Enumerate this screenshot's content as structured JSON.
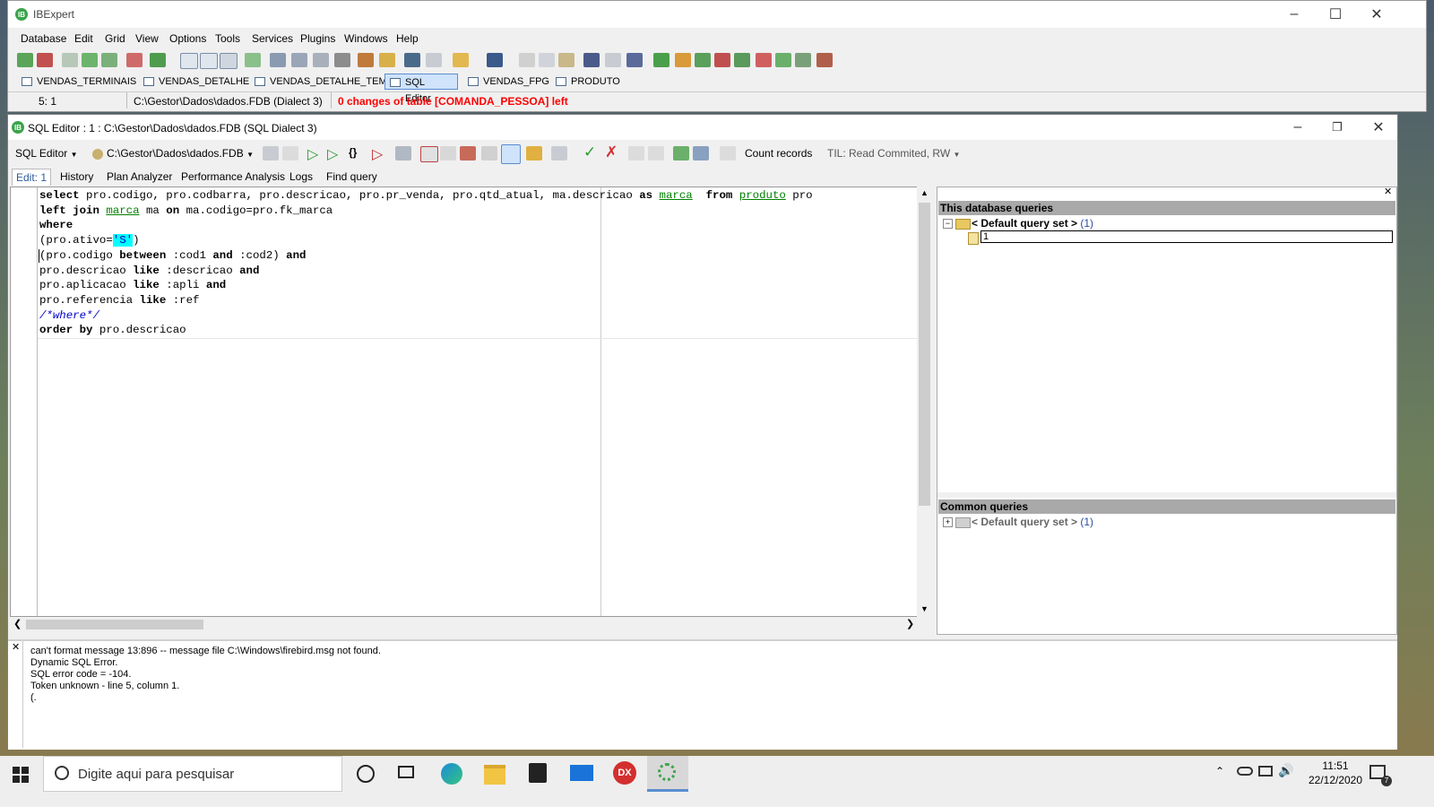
{
  "main_window": {
    "title": "IBExpert",
    "menu": [
      "Database",
      "Edit",
      "Grid",
      "View",
      "Options",
      "Tools",
      "Services",
      "Plugins",
      "Windows",
      "Help"
    ],
    "window_tabs": [
      {
        "label": "VENDAS_TERMINAIS",
        "active": false
      },
      {
        "label": "VENDAS_DETALHE",
        "active": false
      },
      {
        "label": "VENDAS_DETALHE_TEMP",
        "active": false
      },
      {
        "label": "SQL Editor",
        "active": true
      },
      {
        "label": "VENDAS_FPG",
        "active": false
      },
      {
        "label": "PRODUTO",
        "active": false
      }
    ],
    "status": {
      "position": "5:   1",
      "database": "C:\\Gestor\\Dados\\dados.FDB (Dialect 3)",
      "message": "0 changes of table [COMANDA_PESSOA] left"
    }
  },
  "sql_editor": {
    "title": "SQL Editor : 1 : C:\\Gestor\\Dados\\dados.FDB (SQL Dialect 3)",
    "toolbar": {
      "mode": "SQL Editor",
      "database": "C:\\Gestor\\Dados\\dados.FDB",
      "count_records": "Count records",
      "til": "TIL: Read Commited, RW"
    },
    "subtabs": [
      "Edit: 1",
      "History",
      "Plan Analyzer",
      "Performance Analysis",
      "Logs",
      "Find query"
    ],
    "code_lines": {
      "l1_select": "select",
      "l1_cols": " pro.codigo, pro.codbarra, pro.descricao, pro.pr_venda, pro.qtd_atual, ma.descricao ",
      "l1_as": "as",
      "l1_marca": "marca",
      "l1_from": "from",
      "l1_produto": "produto",
      "l1_pro": " pro",
      "l2_left": "left join",
      "l2_marca": "marca",
      "l2_ma": " ma ",
      "l2_on": "on",
      "l2_rest": " ma.codigo=pro.fk_marca",
      "l3": "where",
      "l4_pre": "(pro.ativo=",
      "l4_str": "'S'",
      "l4_post": ")",
      "l5_pre": "(pro.codigo ",
      "l5_between": "between",
      "l5_mid": " :cod1 ",
      "l5_and": "and",
      "l5_mid2": " :cod2) ",
      "l5_and2": "and",
      "l6_pre": "pro.descricao ",
      "l6_like": "like",
      "l6_mid": " :descricao ",
      "l6_and": "and",
      "l7_pre": "pro.aplicacao ",
      "l7_like": "like",
      "l7_mid": " :apli ",
      "l7_and": "and",
      "l8_pre": "pro.referencia ",
      "l8_like": "like",
      "l8_mid": " :ref",
      "l9": "/*where*/",
      "l10_order": "order by",
      "l10_rest": " pro.descricao"
    },
    "right_panel": {
      "db_queries_header": "This database queries",
      "db_query_set": "< Default query set >",
      "db_query_count": "(1)",
      "db_query_item": "1",
      "common_header": "Common queries",
      "common_query_set": "< Default query set >",
      "common_query_count": "(1)"
    },
    "output": [
      "can't format message 13:896 -- message file C:\\Windows\\firebird.msg not found.",
      "Dynamic SQL Error.",
      "SQL error code = -104.",
      "Token unknown - line 5, column 1.",
      "(."
    ]
  },
  "taskbar": {
    "search_placeholder": "Digite aqui para pesquisar",
    "time": "11:51",
    "date": "22/12/2020",
    "notifications": "7"
  },
  "colors": {
    "accent": "#5a8ed0",
    "error_text": "#ff0000",
    "sql_table": "#008000",
    "sql_comment": "#0000cc",
    "string_highlight": "#00ffff"
  }
}
